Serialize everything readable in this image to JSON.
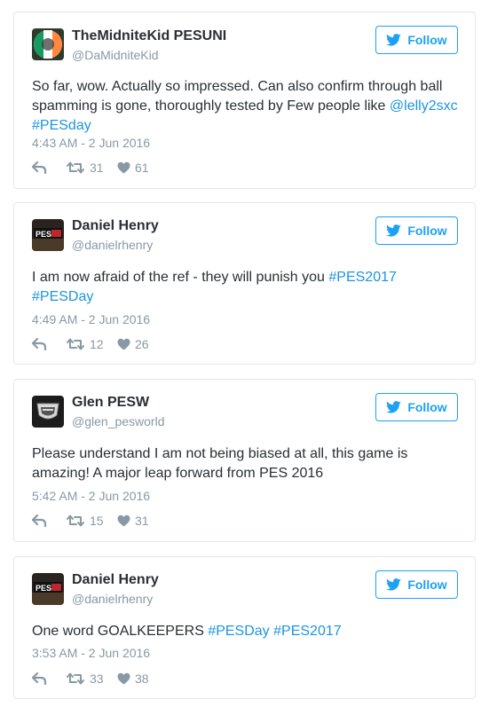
{
  "follow_label": "Follow",
  "tweets": [
    {
      "name": "TheMidniteKid PESUNI",
      "handle": "@DaMidniteKid",
      "text_parts": [
        {
          "t": "So far, wow. Actually so impressed. Can also confirm through ball spamming is gone, thoroughly tested by Few people like ",
          "hl": false
        },
        {
          "t": "@lelly2sxc",
          "hl": true
        },
        {
          "t": " ",
          "hl": false
        },
        {
          "t": "#PESday",
          "hl": true
        }
      ],
      "time": "4:43 AM - 2 Jun 2016",
      "retweets": "31",
      "likes": "61",
      "avatar": "irish-flag-emblem"
    },
    {
      "name": "Daniel Henry",
      "handle": "@danielrhenry",
      "text_parts": [
        {
          "t": "I am now afraid of the ref - they will punish you ",
          "hl": false
        },
        {
          "t": "#PES2017",
          "hl": true
        },
        {
          "t": " ",
          "hl": false
        },
        {
          "t": "#PESDay",
          "hl": true
        }
      ],
      "time": "4:49 AM - 2 Jun 2016",
      "retweets": "12",
      "likes": "26",
      "avatar": "pes-logo"
    },
    {
      "name": "Glen PESW",
      "handle": "@glen_pesworld",
      "text_parts": [
        {
          "t": "Please understand I am not being biased at all, this game is amazing! A major leap forward from PES 2016",
          "hl": false
        }
      ],
      "time": "5:42 AM - 2 Jun 2016",
      "retweets": "15",
      "likes": "31",
      "avatar": "pesworld-badge"
    },
    {
      "name": "Daniel Henry",
      "handle": "@danielrhenry",
      "text_parts": [
        {
          "t": "One word GOALKEEPERS ",
          "hl": false
        },
        {
          "t": "#PESDay",
          "hl": true
        },
        {
          "t": " ",
          "hl": false
        },
        {
          "t": "#PES2017",
          "hl": true
        }
      ],
      "time": "3:53 AM - 2 Jun 2016",
      "retweets": "33",
      "likes": "38",
      "avatar": "pes-logo"
    }
  ]
}
